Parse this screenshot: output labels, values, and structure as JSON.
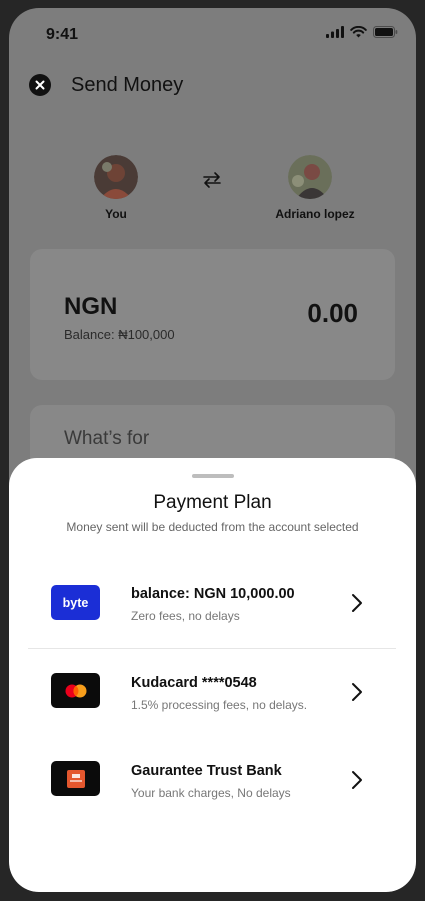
{
  "status_bar": {
    "time": "9:41"
  },
  "header": {
    "title": "Send Money"
  },
  "transfer": {
    "sender_label": "You",
    "recipient_label": "Adriano lopez"
  },
  "amount_card": {
    "currency": "NGN",
    "balance": "Balance: ₦100,000",
    "amount": "0.00"
  },
  "purpose": {
    "placeholder": "What’s for"
  },
  "payment_plan": {
    "title": "Payment Plan",
    "subtitle": "Money sent will be deducted from the account selected",
    "options": [
      {
        "title": "balance: NGN 10,000.00",
        "subtitle": "Zero fees, no delays",
        "logo": "byte",
        "logo_color": "#1b2ed6",
        "icon": "byte-logo"
      },
      {
        "title": "Kudacard ****0548",
        "subtitle": "1.5% processing fees, no delays.",
        "logo_color": "#0b0b0b",
        "icon": "mastercard-logo"
      },
      {
        "title": "Gaurantee Trust Bank",
        "subtitle": "Your bank charges, No delays",
        "logo_color": "#0b0b0b",
        "icon": "gtbank-logo"
      }
    ]
  },
  "colors": {
    "overlay": "#7d7d7d",
    "sheet_bg": "#ffffff",
    "byte_blue": "#1b2ed6",
    "gtbank_orange": "#e4572e"
  }
}
